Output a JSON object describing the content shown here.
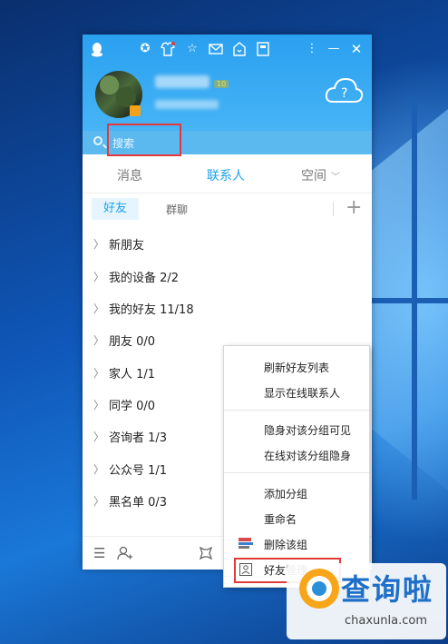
{
  "tabs": {
    "messages": "消息",
    "contacts": "联系人",
    "space": "空间"
  },
  "search": {
    "placeholder": "搜索"
  },
  "header": {
    "level_badge": "10"
  },
  "subtabs": {
    "friends": "好友",
    "groups": "群聊"
  },
  "groups": [
    {
      "label": "新朋友"
    },
    {
      "label": "我的设备 2/2"
    },
    {
      "label": "我的好友 11/18"
    },
    {
      "label": "朋友 0/0"
    },
    {
      "label": "家人 1/1"
    },
    {
      "label": "同学 0/0"
    },
    {
      "label": "咨询者 1/3"
    },
    {
      "label": "公众号 1/1"
    },
    {
      "label": "黑名单 0/3"
    }
  ],
  "context_menu": {
    "items": [
      "刷新好友列表",
      "显示在线联系人",
      "隐身对该分组可见",
      "在线对该分组隐身",
      "添加分组",
      "重命名",
      "删除该组",
      "好友管理"
    ]
  },
  "watermark": {
    "name": "查询啦",
    "url": "chaxunla.com"
  },
  "colors": {
    "accent": "#1ba3f0",
    "header": "#2aa0f0",
    "highlight": "#e23a3a"
  }
}
